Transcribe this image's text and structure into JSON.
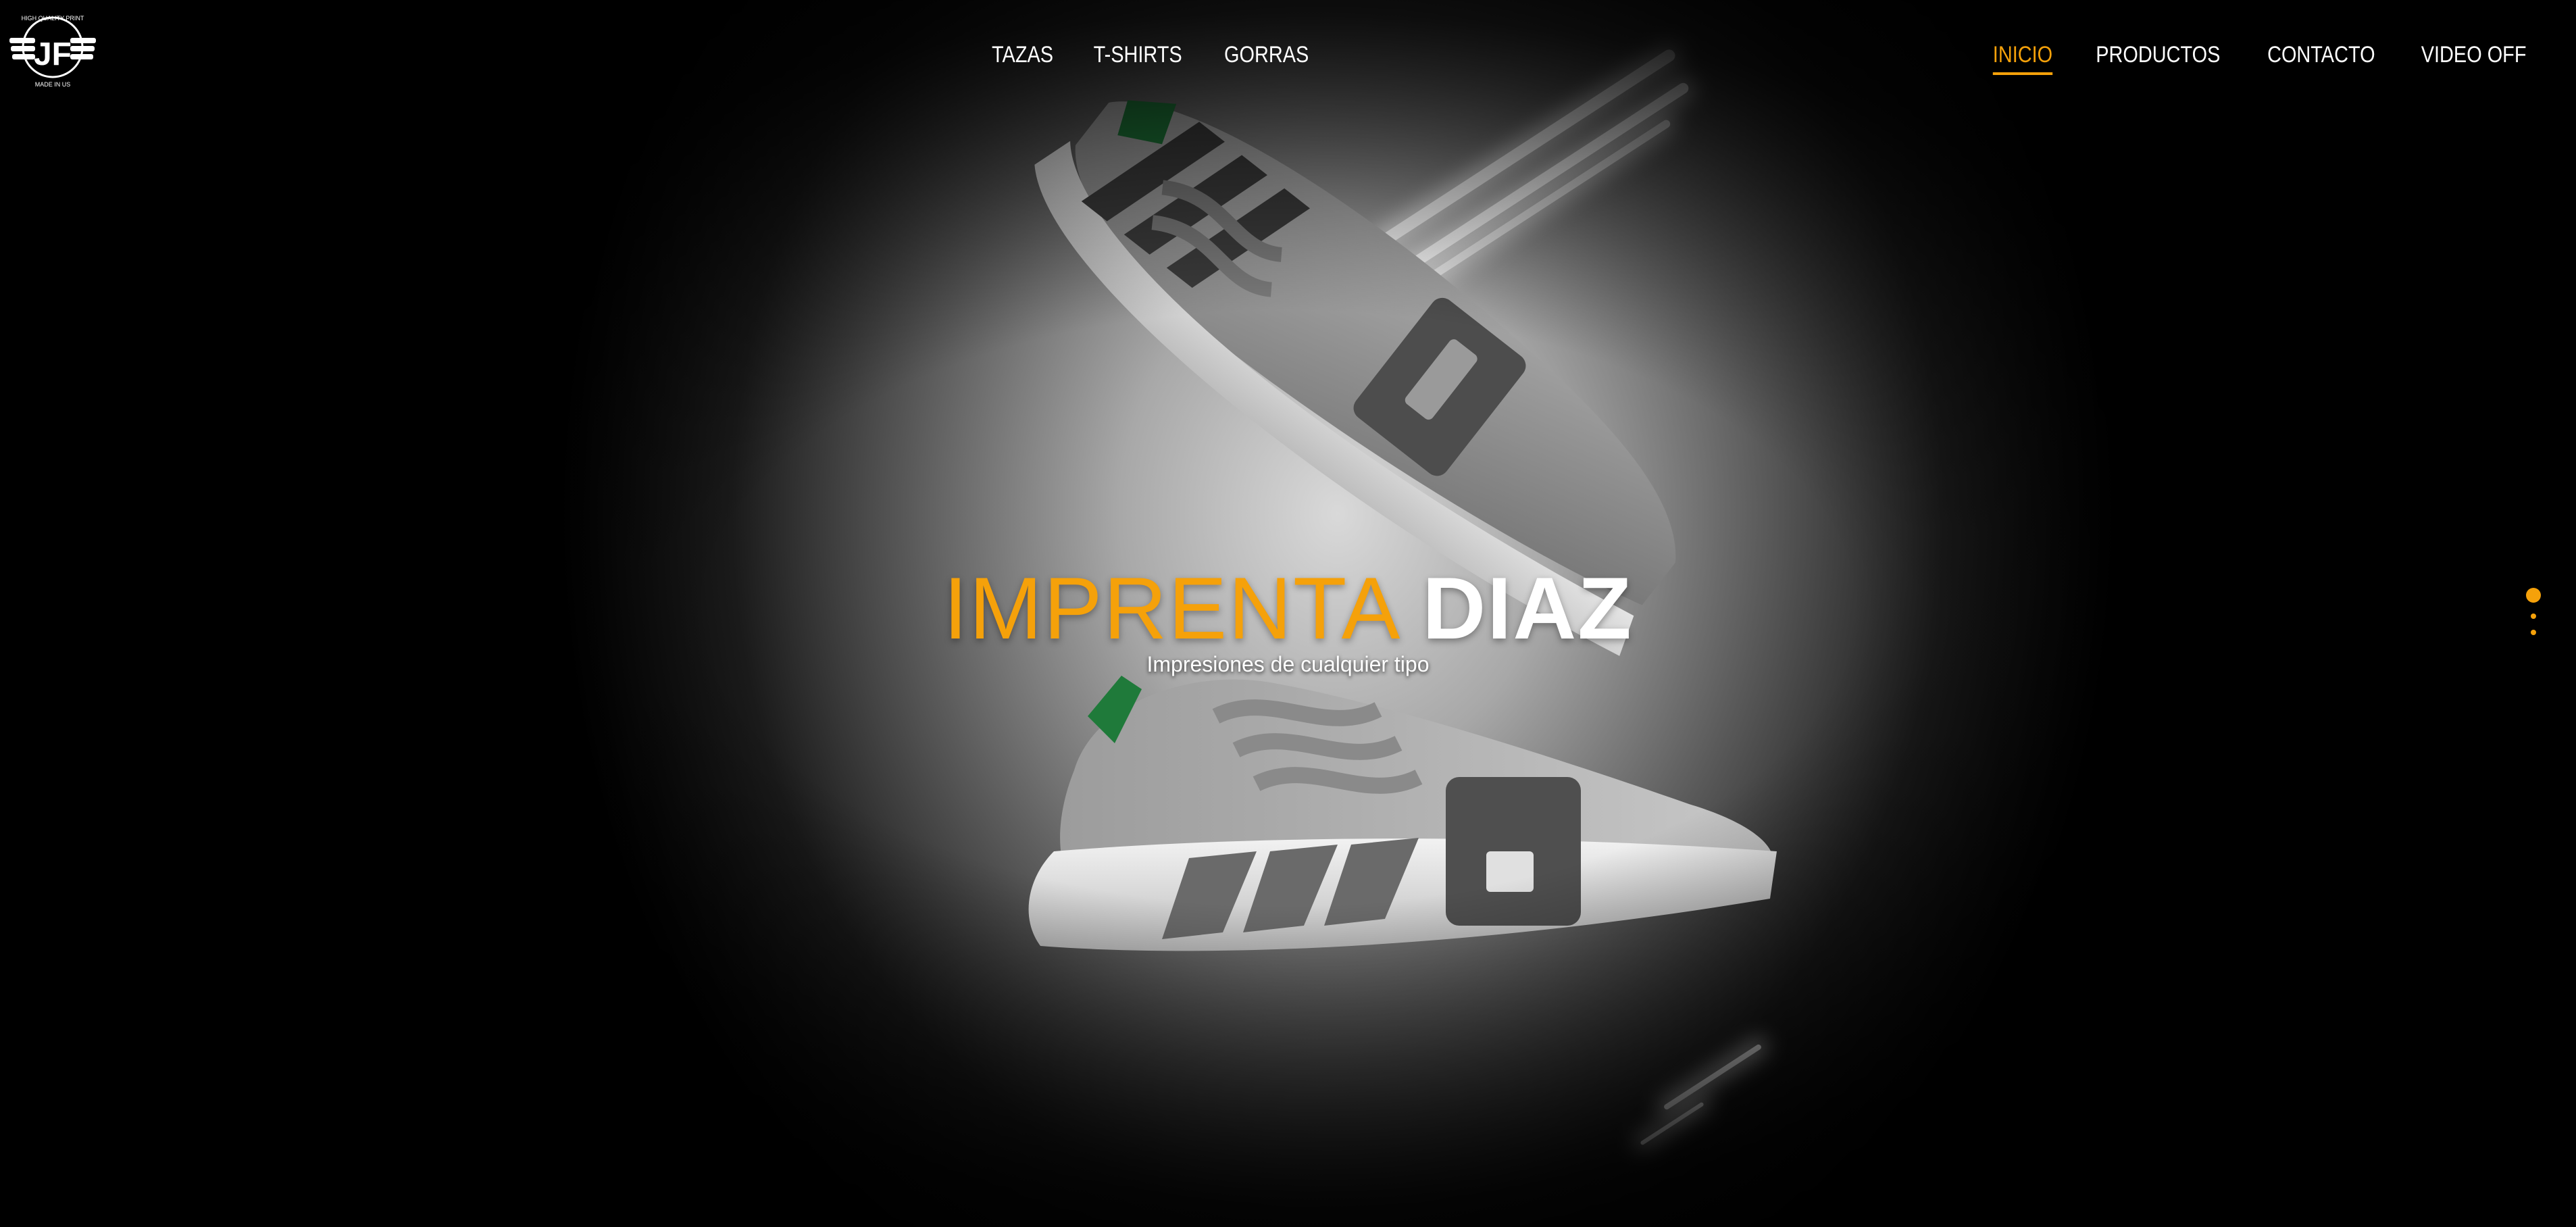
{
  "brand": {
    "logo_top_text": "HIGH QUALITY PRINT",
    "logo_letters": "JF",
    "logo_bottom_text": "MADE IN US"
  },
  "nav_center": [
    {
      "label": "TAZAS"
    },
    {
      "label": "T-SHIRTS"
    },
    {
      "label": "GORRAS"
    }
  ],
  "nav_right": [
    {
      "label": "INICIO",
      "active": true
    },
    {
      "label": "PRODUCTOS"
    },
    {
      "label": "CONTACTO"
    },
    {
      "label": "VIDEO OFF"
    }
  ],
  "hero": {
    "title_part1": "IMPRENTA",
    "title_part2": "DIAZ",
    "subtitle": "Impresiones de cualquier tipo"
  },
  "slider": {
    "slide_count": 3,
    "active_index": 0
  },
  "colors": {
    "accent": "#f5a10a",
    "background": "#000000",
    "text": "#ffffff"
  }
}
